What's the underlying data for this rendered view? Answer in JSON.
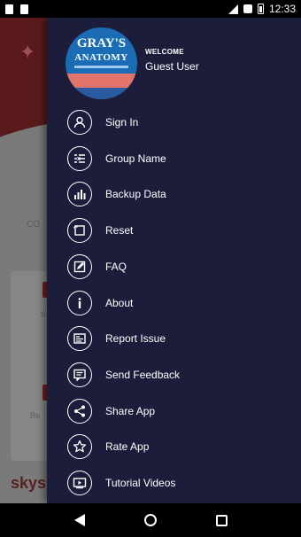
{
  "status_bar": {
    "time": "12:33",
    "left_icons": [
      "notification-icon",
      "android-icon"
    ],
    "right_icons": [
      "signal-icon",
      "sim-icon",
      "battery-icon"
    ]
  },
  "background_app": {
    "text_1": "CO",
    "card_1_text": "S",
    "card_2_text": "Re",
    "brand_partial": "skys"
  },
  "drawer": {
    "book_cover": {
      "title_line_1": "GRAY'S",
      "title_line_2": "ANATOMY"
    },
    "welcome_label": "WELCOME",
    "user_name": "Guest User",
    "items": [
      {
        "label": "Sign In",
        "icon": "user-icon"
      },
      {
        "label": "Group Name",
        "icon": "group-list-icon"
      },
      {
        "label": "Backup Data",
        "icon": "bar-chart-icon"
      },
      {
        "label": "Reset",
        "icon": "reset-icon"
      },
      {
        "label": "FAQ",
        "icon": "edit-icon"
      },
      {
        "label": "About",
        "icon": "info-icon"
      },
      {
        "label": "Report Issue",
        "icon": "report-icon"
      },
      {
        "label": "Send Feedback",
        "icon": "feedback-icon"
      },
      {
        "label": "Share App",
        "icon": "share-icon"
      },
      {
        "label": "Rate App",
        "icon": "star-icon"
      },
      {
        "label": "Tutorial Videos",
        "icon": "video-icon"
      }
    ]
  },
  "colors": {
    "drawer_background": "#1c1d3b",
    "text": "#ffffff",
    "book_blue": "#1a6db5"
  }
}
